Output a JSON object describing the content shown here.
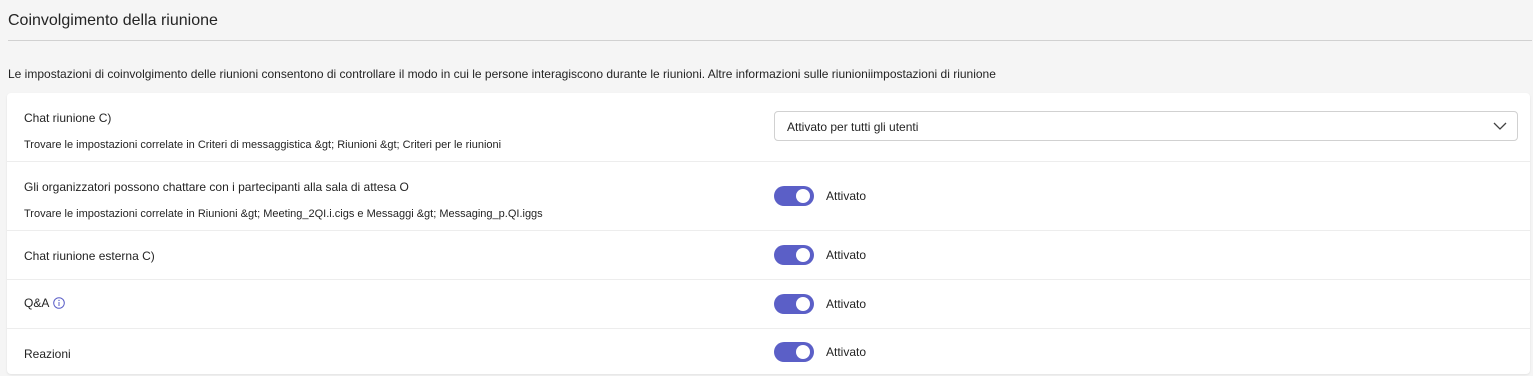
{
  "header": {
    "title": "Coinvolgimento della riunione"
  },
  "description": "Le impostazioni di coinvolgimento delle riunioni consentono di controllare il modo in cui le persone interagiscono durante le riunioni. Altre informazioni sulle riunioniimpostazioni di riunione",
  "settings": [
    {
      "label": "Chat riunione C)",
      "sublabel": "Trovare le impostazioni correlate in Criteri di messaggistica &gt; Riunioni &gt; Criteri per le riunioni",
      "control": "dropdown",
      "value": "Attivato per tutti gli utenti"
    },
    {
      "label": "Gli organizzatori possono chattare con i partecipanti alla sala di attesa O",
      "sublabel": "Trovare le impostazioni correlate in Riunioni &gt; Meeting_2QI.i.cigs e Messaggi &gt; Messaging_p.QI.iggs",
      "control": "toggle",
      "value": "Attivato",
      "on": true
    },
    {
      "label": "Chat riunione esterna C)",
      "control": "toggle",
      "value": "Attivato",
      "on": true
    },
    {
      "label": "Q&A",
      "control": "toggle",
      "value": "Attivato",
      "on": true,
      "icon": "info-icon"
    },
    {
      "label": "Reazioni",
      "control": "toggle",
      "value": "Attivato",
      "on": true
    }
  ],
  "colors": {
    "accent": "#5b5fc7",
    "background": "#f5f5f5",
    "card": "#ffffff"
  }
}
